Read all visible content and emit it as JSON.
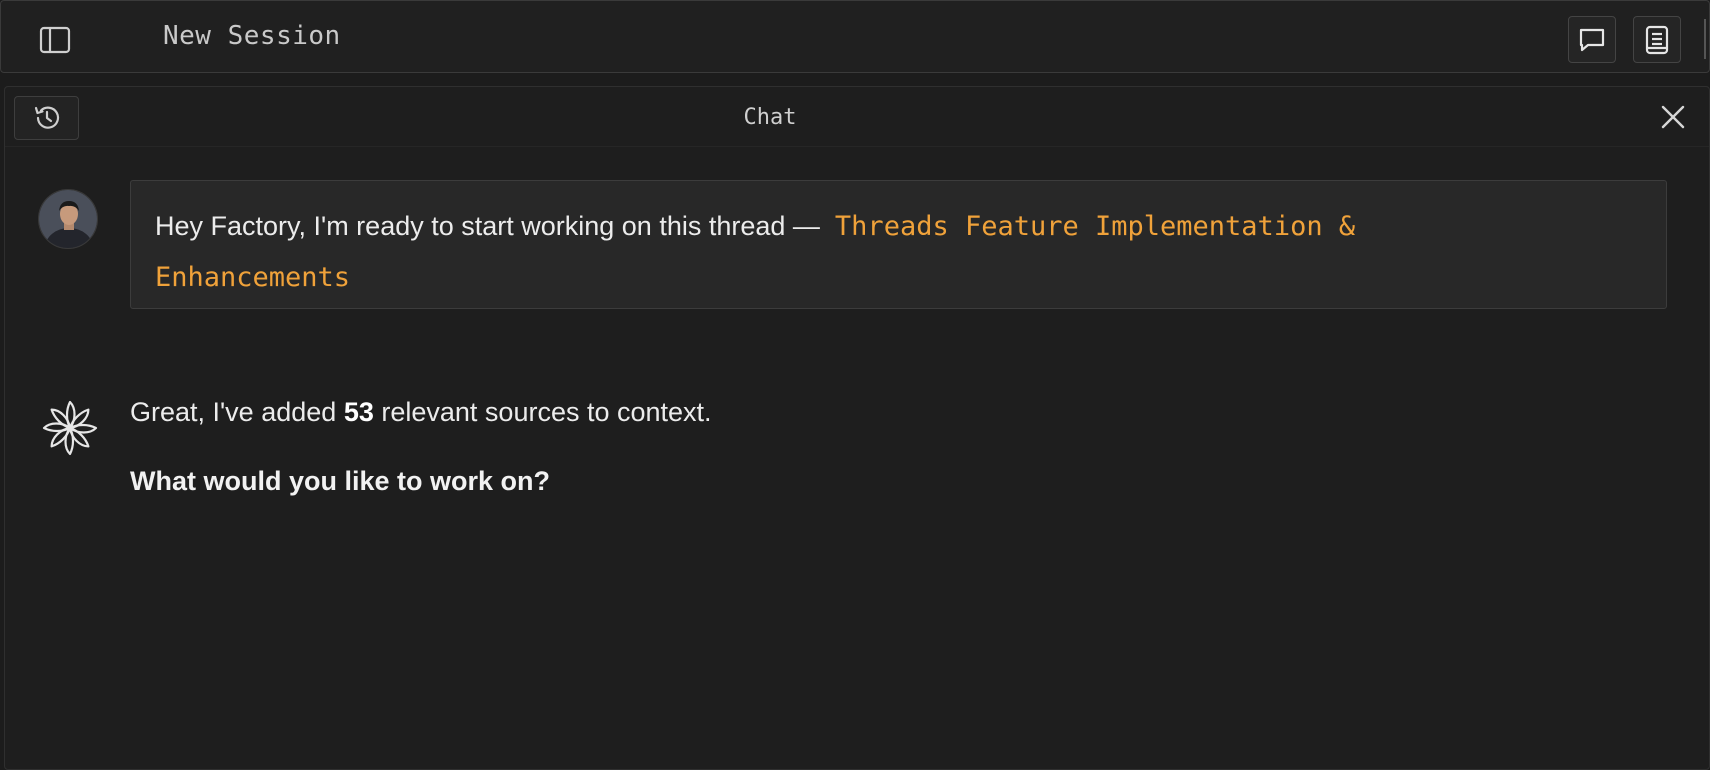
{
  "topbar": {
    "session_title": "New Session",
    "icons": {
      "sidebar_toggle": "sidebar-toggle-icon",
      "chat": "chat-bubble-icon",
      "notes": "document-icon"
    }
  },
  "panel": {
    "title": "Chat",
    "icons": {
      "history": "history-icon",
      "close": "close-icon"
    }
  },
  "messages": {
    "user": {
      "text": "Hey Factory, I'm ready to start working on this thread —",
      "thread_name_line1": "Threads Feature Implementation &",
      "thread_name_line2": "Enhancements"
    },
    "assistant": {
      "prefix": "Great, I've added",
      "count": "53",
      "suffix": "relevant sources to context.",
      "question": "What would you like to work on?"
    }
  },
  "colors": {
    "accent": "#f0a23a",
    "background": "#1c1c1c",
    "text": "#e6e6e6"
  }
}
